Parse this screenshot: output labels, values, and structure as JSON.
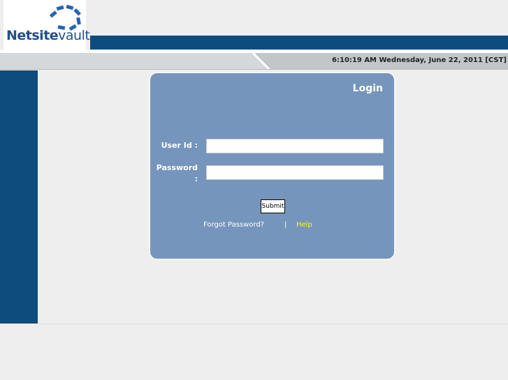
{
  "logo": {
    "text_bold": "Netsite",
    "text_thin": "vault"
  },
  "header": {
    "datetime": "6:10:19 AM Wednesday, June 22, 2011 [CST]"
  },
  "login": {
    "title": "Login",
    "user_id_label": "User Id :",
    "password_label_line1": "Password",
    "password_label_line2": ":",
    "user_id_value": "",
    "password_value": "",
    "submit_label": "Submit",
    "forgot_password": "Forgot Password?",
    "separator": "|",
    "help": "Help"
  },
  "colors": {
    "brand_navy": "#0f4c7e",
    "panel_blue": "#7695bc",
    "help_link": "#ffff00",
    "page_bg": "#eeeeee"
  }
}
